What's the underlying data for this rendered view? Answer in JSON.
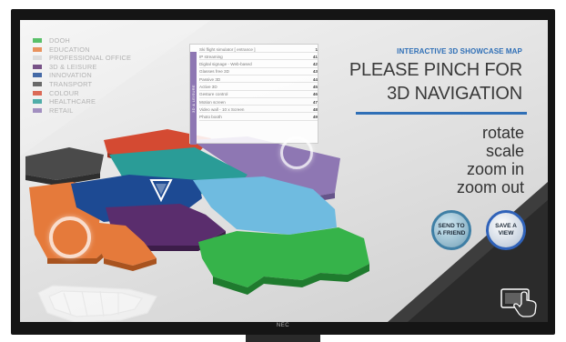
{
  "monitor": {
    "brand": "NEC"
  },
  "legend": [
    {
      "label": "DOOH",
      "color": "#36b34a"
    },
    {
      "label": "EDUCATION",
      "color": "#e57a3b"
    },
    {
      "label": "PROFESSIONAL OFFICE",
      "color": "#d5d5d5"
    },
    {
      "label": "3D & LEISURE",
      "color": "#5a2d6d"
    },
    {
      "label": "INNOVATION",
      "color": "#1d4a93"
    },
    {
      "label": "TRANSPORT",
      "color": "#4a4a4a"
    },
    {
      "label": "COLOUR",
      "color": "#d44a32"
    },
    {
      "label": "HEALTHCARE",
      "color": "#2a9c97"
    },
    {
      "label": "RETAIL",
      "color": "#8e77b3"
    }
  ],
  "poi_panel": {
    "category": "3D & LEISURE",
    "items": [
      {
        "name": "Ski flight simulator [ entrance ]",
        "number": "1"
      },
      {
        "name": "IP streaming",
        "number": "41"
      },
      {
        "name": "Digital signage - Web-based",
        "number": "42"
      },
      {
        "name": "Glasses free 3D",
        "number": "43"
      },
      {
        "name": "Passive 3D",
        "number": "44"
      },
      {
        "name": "Active 3D",
        "number": "45"
      },
      {
        "name": "Gesture control",
        "number": "46"
      },
      {
        "name": "Motion screen",
        "number": "47"
      },
      {
        "name": "Video wall - 10 x Screen",
        "number": "48"
      },
      {
        "name": "Photo booth",
        "number": "49"
      }
    ]
  },
  "header": {
    "subtitle": "INTERACTIVE 3D SHOWCASE MAP",
    "headline_line1": "PLEASE PINCH FOR",
    "headline_line2": "3D NAVIGATION"
  },
  "gestures": [
    "rotate",
    "scale",
    "zoom in",
    "zoom out"
  ],
  "buttons": {
    "send_line1": "SEND TO",
    "send_line2": "A FRIEND",
    "save_line1": "SAVE A",
    "save_line2": "VIEW"
  },
  "colors": {
    "accent": "#2f6fb6",
    "map_green": "#36b34a",
    "map_light_blue": "#6fbbe0",
    "map_navy": "#1d4a93",
    "map_purple": "#5a2d6d",
    "map_lilac": "#8e77b3",
    "map_orange": "#e57a3b",
    "map_red": "#d44a32",
    "map_teal": "#2a9c97",
    "map_dark": "#4a4a4a"
  },
  "icons": {
    "touch_gesture": "hand-touch-icon",
    "map_marker": "chevron-marker-icon"
  }
}
